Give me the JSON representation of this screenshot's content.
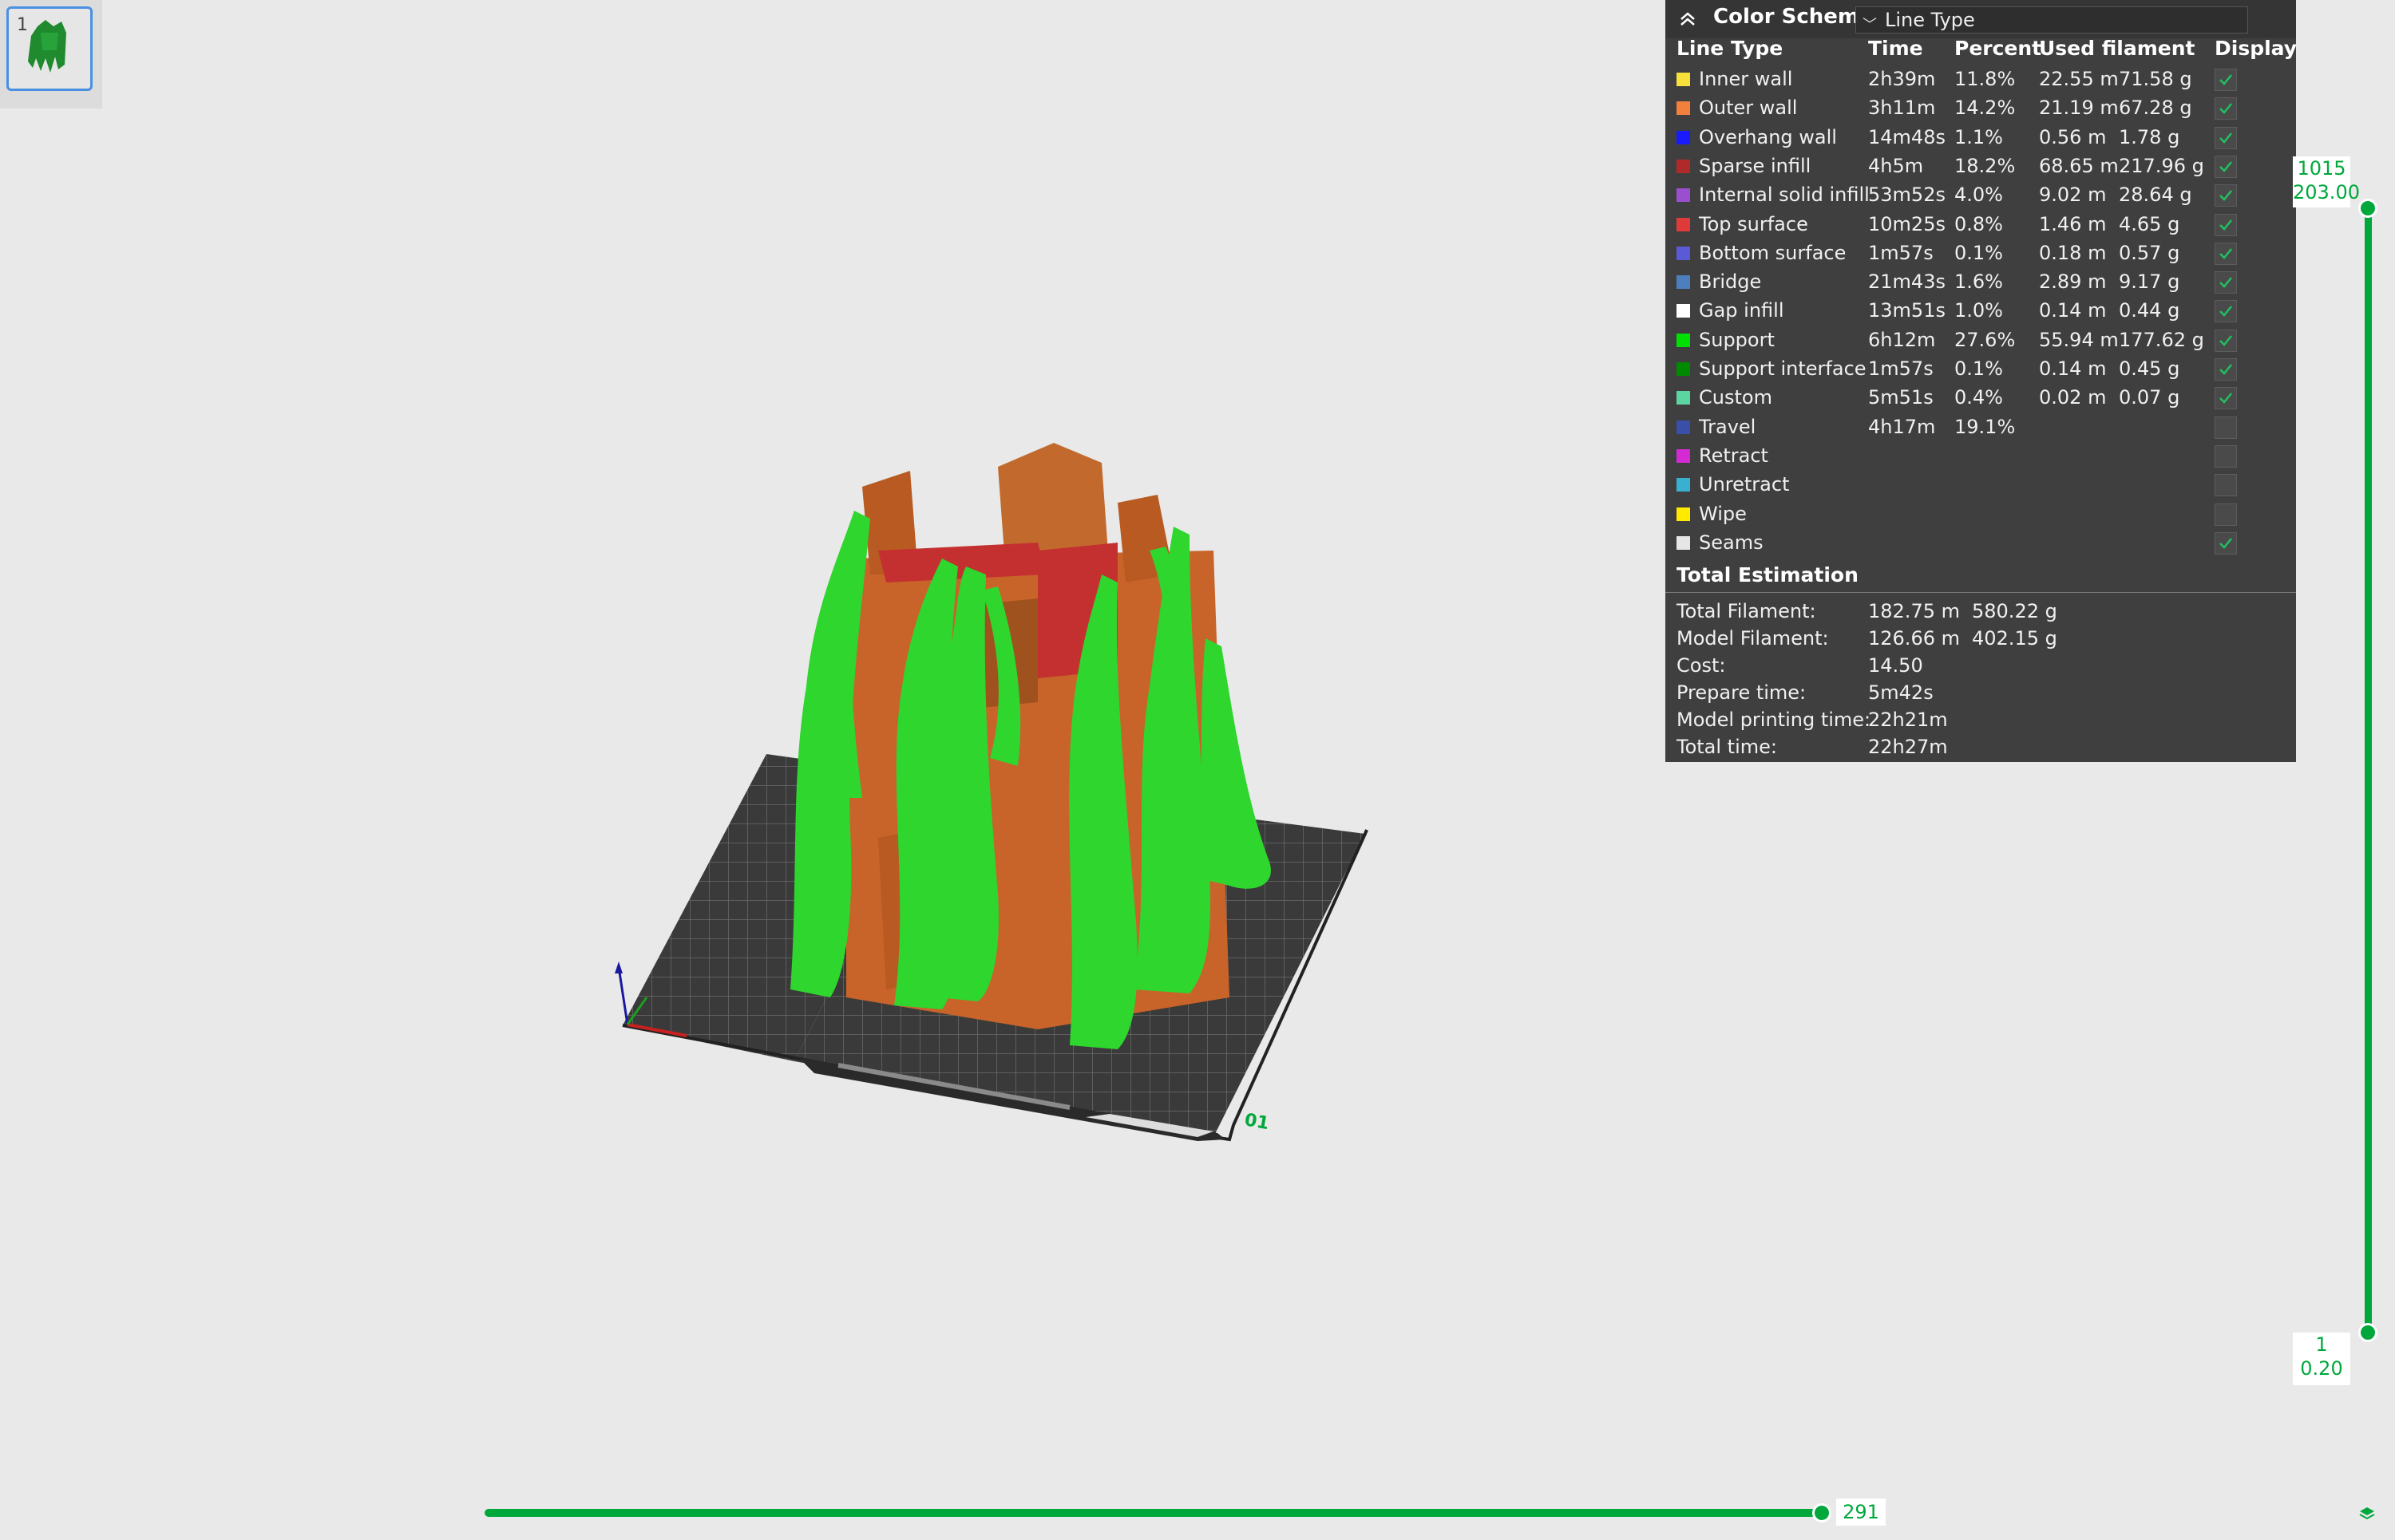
{
  "thumbnail": {
    "index": "1"
  },
  "legend": {
    "title": "Color Scheme",
    "selected_scheme": "Line Type",
    "columns": {
      "type": "Line Type",
      "time": "Time",
      "percent": "Percent",
      "used": "Used filament",
      "display": "Display"
    },
    "rows": [
      {
        "name": "Inner wall",
        "color": "#f7e03a",
        "time": "2h39m",
        "percent": "11.8%",
        "length": "22.55 m",
        "weight": "71.58 g",
        "checked": true
      },
      {
        "name": "Outer wall",
        "color": "#f0803c",
        "time": "3h11m",
        "percent": "14.2%",
        "length": "21.19 m",
        "weight": "67.28 g",
        "checked": true
      },
      {
        "name": "Overhang wall",
        "color": "#1a1aff",
        "time": "14m48s",
        "percent": "1.1%",
        "length": "0.56 m",
        "weight": "1.78 g",
        "checked": true
      },
      {
        "name": "Sparse infill",
        "color": "#b02a2a",
        "time": "4h5m",
        "percent": "18.2%",
        "length": "68.65 m",
        "weight": "217.96 g",
        "checked": true
      },
      {
        "name": "Internal solid infill",
        "color": "#9a4fcf",
        "time": "53m52s",
        "percent": "4.0%",
        "length": "9.02 m",
        "weight": "28.64 g",
        "checked": true
      },
      {
        "name": "Top surface",
        "color": "#e03a3a",
        "time": "10m25s",
        "percent": "0.8%",
        "length": "1.46 m",
        "weight": "4.65 g",
        "checked": true
      },
      {
        "name": "Bottom surface",
        "color": "#5a5ad6",
        "time": "1m57s",
        "percent": "0.1%",
        "length": "0.18 m",
        "weight": "0.57 g",
        "checked": true
      },
      {
        "name": "Bridge",
        "color": "#4d7fbf",
        "time": "21m43s",
        "percent": "1.6%",
        "length": "2.89 m",
        "weight": "9.17 g",
        "checked": true
      },
      {
        "name": "Gap infill",
        "color": "#ffffff",
        "time": "13m51s",
        "percent": "1.0%",
        "length": "0.14 m",
        "weight": "0.44 g",
        "checked": true
      },
      {
        "name": "Support",
        "color": "#00e000",
        "time": "6h12m",
        "percent": "27.6%",
        "length": "55.94 m",
        "weight": "177.62 g",
        "checked": true
      },
      {
        "name": "Support interface",
        "color": "#008a00",
        "time": "1m57s",
        "percent": "0.1%",
        "length": "0.14 m",
        "weight": "0.45 g",
        "checked": true
      },
      {
        "name": "Custom",
        "color": "#5cd6a0",
        "time": "5m51s",
        "percent": "0.4%",
        "length": "0.02 m",
        "weight": "0.07 g",
        "checked": true
      },
      {
        "name": "Travel",
        "color": "#3a4fa8",
        "time": "4h17m",
        "percent": "19.1%",
        "length": "",
        "weight": "",
        "checked": false
      },
      {
        "name": "Retract",
        "color": "#d42ad4",
        "time": "",
        "percent": "",
        "length": "",
        "weight": "",
        "checked": false
      },
      {
        "name": "Unretract",
        "color": "#3ab0d0",
        "time": "",
        "percent": "",
        "length": "",
        "weight": "",
        "checked": false
      },
      {
        "name": "Wipe",
        "color": "#ffea00",
        "time": "",
        "percent": "",
        "length": "",
        "weight": "",
        "checked": false
      },
      {
        "name": "Seams",
        "color": "#e6e6e6",
        "time": "",
        "percent": "",
        "length": "",
        "weight": "",
        "checked": true
      }
    ],
    "total_title": "Total Estimation",
    "estimation": [
      {
        "label": "Total Filament:",
        "v1": "182.75 m",
        "v2": "580.22 g"
      },
      {
        "label": "Model Filament:",
        "v1": "126.66 m",
        "v2": "402.15 g"
      },
      {
        "label": "Cost:",
        "v1": "14.50",
        "v2": ""
      },
      {
        "label": "Prepare time:",
        "v1": "5m42s",
        "v2": ""
      },
      {
        "label": "Model printing time:",
        "v1": "22h21m",
        "v2": ""
      },
      {
        "label": "Total time:",
        "v1": "22h27m",
        "v2": ""
      }
    ]
  },
  "layer_slider": {
    "top_layer": "1015",
    "top_height": "203.00",
    "bottom_layer": "1",
    "bottom_height": "0.20"
  },
  "move_slider": {
    "value": "291",
    "fraction": 1.0
  },
  "colors": {
    "accent": "#00a83c",
    "support": "#2ed62e",
    "model": "#c8642a",
    "top": "#c43030",
    "plate": "#3a3a3a"
  }
}
